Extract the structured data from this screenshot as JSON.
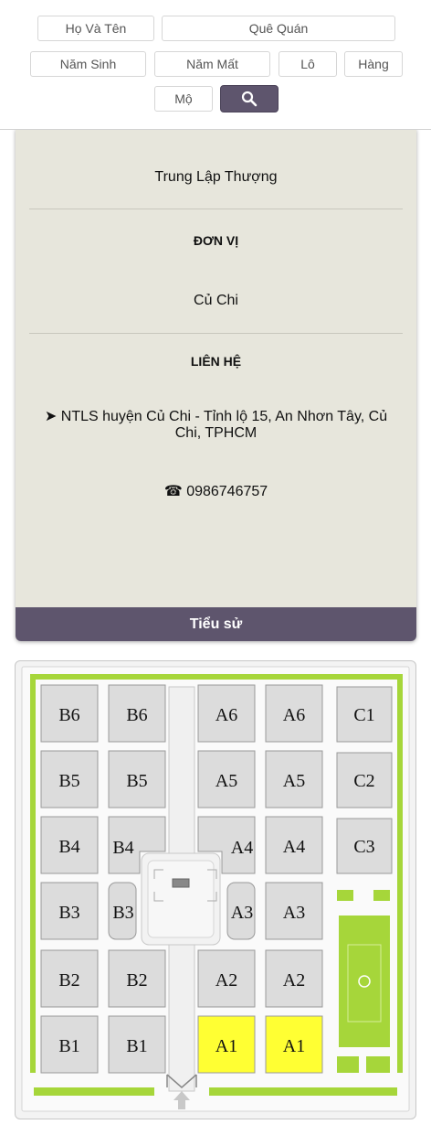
{
  "search": {
    "ho_ten": "Họ Và Tên",
    "que_quan": "Quê Quán",
    "nam_sinh": "Năm Sinh",
    "nam_mat": "Năm Mất",
    "lo": "Lô",
    "hang": "Hàng",
    "mo": "Mộ",
    "button_icon": "search-icon"
  },
  "details": {
    "que_quan_value": "Trung Lập Thượng",
    "don_vi_label": "ĐƠN VỊ",
    "don_vi_value": "Củ Chi",
    "lien_he_label": "LIÊN HỆ",
    "address": "➤ NTLS huyện Củ Chi - Tỉnh lộ 15, An Nhơn Tây, Củ Chi, TPHCM",
    "phone": "☎ 0986746757",
    "bio_button": "Tiểu sử"
  },
  "map": {
    "plots": {
      "b6a": "B6",
      "b6b": "B6",
      "a6a": "A6",
      "a6b": "A6",
      "c1": "C1",
      "b5a": "B5",
      "b5b": "B5",
      "a5a": "A5",
      "a5b": "A5",
      "c2": "C2",
      "b4a": "B4",
      "b4b": "B4",
      "a4a": "A4",
      "a4b": "A4",
      "c3": "C3",
      "b3a": "B3",
      "b3b": "B3",
      "a3a": "A3",
      "a3b": "A3",
      "b2a": "B2",
      "b2b": "B2",
      "a2a": "A2",
      "a2b": "A2",
      "b1a": "B1",
      "b1b": "B1",
      "a1a": "A1",
      "a1b": "A1"
    },
    "highlighted": "A1",
    "colors": {
      "highlight": "#ffff33",
      "plot": "#dcdcdc",
      "hedge": "#a6d63a",
      "accent": "#5e556d"
    }
  }
}
